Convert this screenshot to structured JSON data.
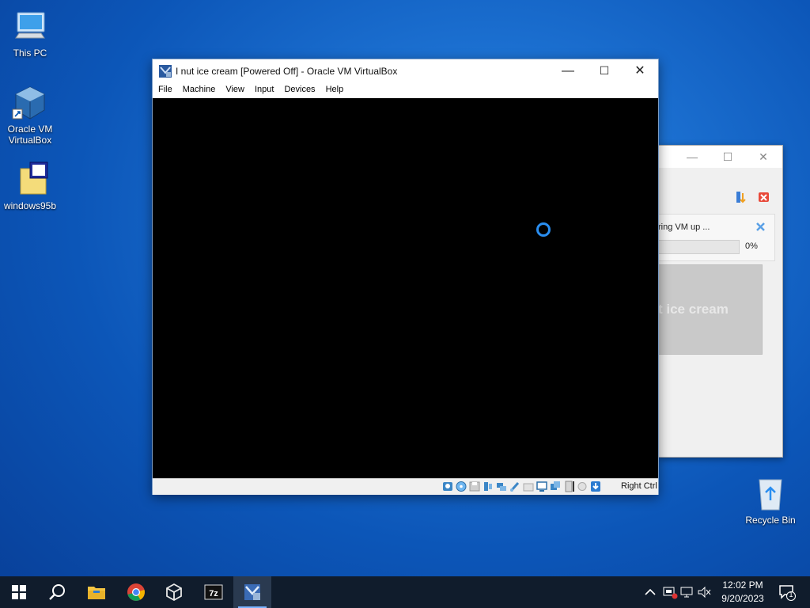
{
  "desktop": {
    "icons": [
      {
        "label": "This PC"
      },
      {
        "label": "Oracle VM VirtualBox"
      },
      {
        "label": "windows95b"
      },
      {
        "label": "Recycle Bin"
      }
    ]
  },
  "vm_window": {
    "title": "I nut ice cream [Powered Off] - Oracle VM VirtualBox",
    "menu": [
      "File",
      "Machine",
      "View",
      "Input",
      "Devices",
      "Help"
    ],
    "host_key": "Right Ctrl"
  },
  "progress_window": {
    "status_text": "ring VM up ...",
    "percent": "0%",
    "progress_fraction": 0,
    "preview_label": "t ice cream"
  },
  "taskbar": {
    "time": "12:02 PM",
    "date": "9/20/2023",
    "notification_count": "1",
    "apps": [
      "start-icon",
      "search-icon",
      "file-explorer-icon",
      "chrome-icon",
      "virtualbox-icon",
      "7zip-icon",
      "vm-window-icon"
    ]
  },
  "colors": {
    "accent": "#2a8ef0",
    "taskbar": "#101c2c",
    "desktop": "#1b6fd0"
  }
}
